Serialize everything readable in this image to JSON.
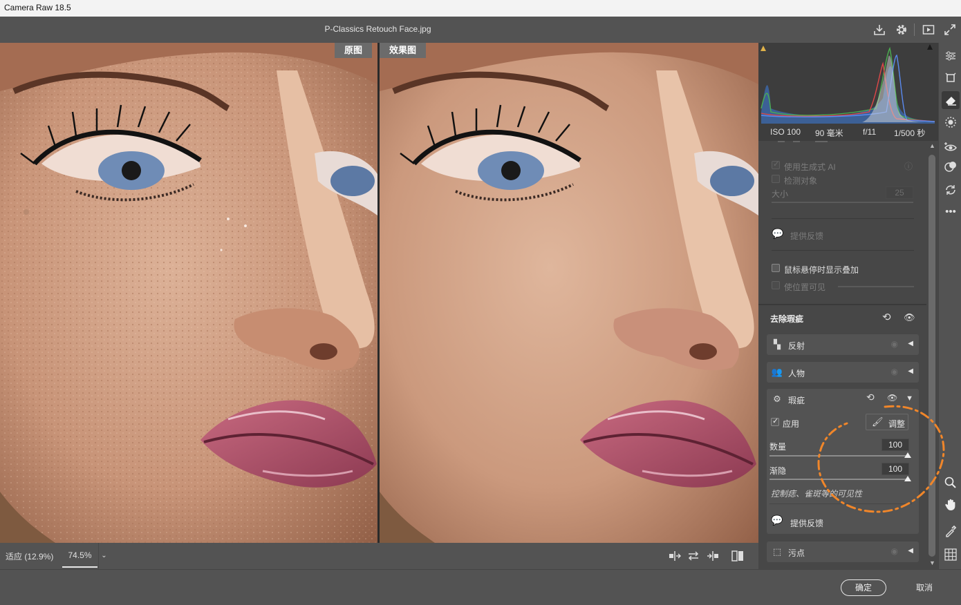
{
  "window": {
    "title": "Camera Raw 18.5"
  },
  "header": {
    "filename": "P-Classics Retouch Face.jpg",
    "icons": [
      "save-icon",
      "gear-icon",
      "slideshow-icon",
      "fullscreen-icon"
    ]
  },
  "viewer": {
    "before_label": "原图",
    "after_label": "效果图"
  },
  "zoom": {
    "fit_label": "适应 (12.9%)",
    "current": "74.5%"
  },
  "exif": {
    "iso": "ISO 100",
    "focal": "90 毫米",
    "aperture": "f/11",
    "shutter": "1/500 秒"
  },
  "panel": {
    "use_ai_label": "使用生成式 AI",
    "detect_objects_label": "检测对象",
    "size_label": "大小",
    "size_value": "25",
    "feedback_label": "提供反馈",
    "hover_overlay_label": "鼠标悬停时显示叠加",
    "visualize_label": "使位置可见",
    "distraction_title": "去除瑕疵",
    "sections": {
      "reflection": "反射",
      "people": "人物",
      "blemish": "瑕疵",
      "dust": "污点"
    },
    "apply_label": "应用",
    "adjust_label": "调整",
    "amount_label": "数量",
    "amount_value": "100",
    "amount_level": 1.0,
    "fade_label": "渐隐",
    "fade_value": "100",
    "fade_level": 1.0,
    "hint": "控制痣、雀斑等的可见性",
    "feedback2_label": "提供反馈"
  },
  "footer": {
    "ok": "确定",
    "cancel": "取消"
  },
  "colors": {
    "annotation": "#f0862a",
    "panel": "#474747",
    "background": "#535353"
  }
}
